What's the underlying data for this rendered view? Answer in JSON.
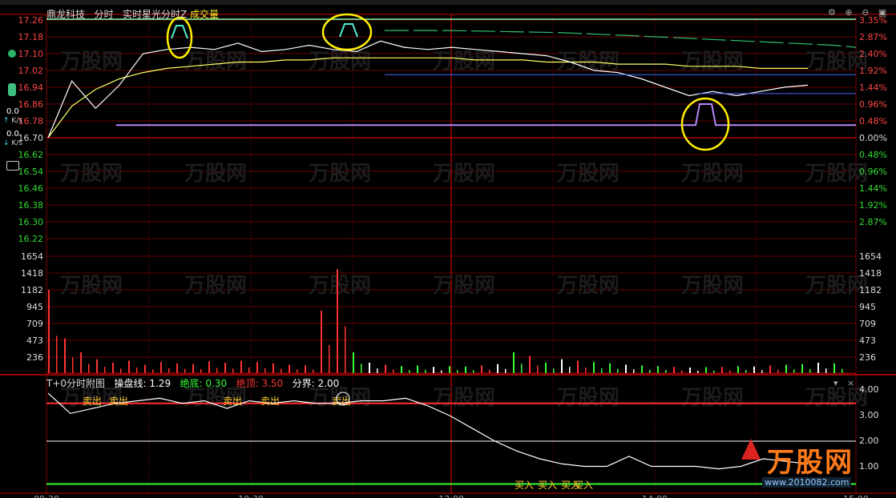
{
  "header": {
    "stock_name": "鼎龙科技",
    "tab_fenshi": "分时",
    "indicator": "实时星光分时Z",
    "volume_label": "成交量"
  },
  "sidebar": {
    "up_value": "0.0",
    "up_unit": "K/s",
    "down_value": "0.0",
    "down_unit": "K/s"
  },
  "price_axis": {
    "left": [
      "17.26",
      "17.18",
      "17.10",
      "17.02",
      "16.94",
      "16.86",
      "16.78",
      "16.70",
      "16.62",
      "16.54",
      "16.46",
      "16.38",
      "16.30",
      "16.22"
    ],
    "right": [
      "3.35%",
      "2.87%",
      "2.40%",
      "1.92%",
      "1.44%",
      "0.96%",
      "0.48%",
      "0.00%",
      "0.48%",
      "0.96%",
      "1.44%",
      "1.92%",
      "2.87%"
    ]
  },
  "volume_axis": [
    "1654",
    "1418",
    "1182",
    "945",
    "709",
    "473",
    "236"
  ],
  "time_axis": [
    "09:30",
    "10:30",
    "13:00",
    "14:00",
    "15:00"
  ],
  "sub_panel": {
    "title": "T+0分时附图",
    "line_label": "操盘线:",
    "line_value": "1.29",
    "bottom_label": "绝底:",
    "bottom_value": "0.30",
    "top_label": "绝顶:",
    "top_value": "3.50",
    "split_label": "分界:",
    "split_value": "2.00",
    "axis": [
      "4.00",
      "3.00",
      "2.00",
      "1.00"
    ],
    "sell_labels": [
      "卖出",
      "卖出",
      "卖出",
      "卖出",
      "卖出"
    ],
    "buy_labels": [
      "买入",
      "买入",
      "买入",
      "买入"
    ]
  },
  "watermark": {
    "brand": "万股网",
    "url": "www.2010082.com"
  },
  "colors": {
    "grid_red": "#8b0000",
    "price_line": "#ffffff",
    "avg_line": "#ffff66",
    "purple": "#b589ff",
    "green": "#33ff33",
    "red": "#ff3333",
    "circle": "#ffee00"
  },
  "chart_data": {
    "type": "line",
    "price_series": [
      16.7,
      16.97,
      16.84,
      16.95,
      17.1,
      17.12,
      17.13,
      17.12,
      17.15,
      17.11,
      17.12,
      17.14,
      17.12,
      17.11,
      17.16,
      17.13,
      17.12,
      17.13,
      17.12,
      17.11,
      17.1,
      17.09,
      17.06,
      17.02,
      17.01,
      16.98,
      16.94,
      16.9,
      16.92,
      16.9,
      16.92,
      16.94,
      16.95
    ],
    "avg_series": [
      16.7,
      16.85,
      16.93,
      16.98,
      17.01,
      17.03,
      17.04,
      17.05,
      17.06,
      17.06,
      17.07,
      17.07,
      17.08,
      17.08,
      17.08,
      17.08,
      17.08,
      17.08,
      17.07,
      17.07,
      17.07,
      17.06,
      17.06,
      17.06,
      17.05,
      17.05,
      17.05,
      17.04,
      17.04,
      17.04,
      17.03,
      17.03,
      17.03
    ],
    "volumes": [
      1200,
      500,
      300,
      200,
      150,
      180,
      120,
      160,
      140,
      130,
      170,
      150,
      180,
      160,
      140,
      120,
      110,
      900,
      1500,
      300,
      150,
      120,
      100,
      110,
      90,
      100,
      95,
      110,
      130,
      300,
      250,
      150,
      200,
      180,
      160,
      140,
      120,
      110,
      100,
      90,
      80,
      85,
      90,
      100,
      95,
      110,
      120,
      130,
      150,
      140
    ],
    "sub_series": [
      3.9,
      3.1,
      3.3,
      3.5,
      3.6,
      3.7,
      3.5,
      3.6,
      3.3,
      3.6,
      3.5,
      3.6,
      3.5,
      3.5,
      3.6,
      3.6,
      3.7,
      3.4,
      3.0,
      2.5,
      2.0,
      1.6,
      1.3,
      1.1,
      1.0,
      1.0,
      1.4,
      1.0,
      1.0,
      1.0,
      0.9,
      1.0,
      1.3,
      1.2,
      1.1
    ],
    "sub_levels": {
      "top": 3.5,
      "split": 2.0,
      "bottom": 0.3
    }
  }
}
